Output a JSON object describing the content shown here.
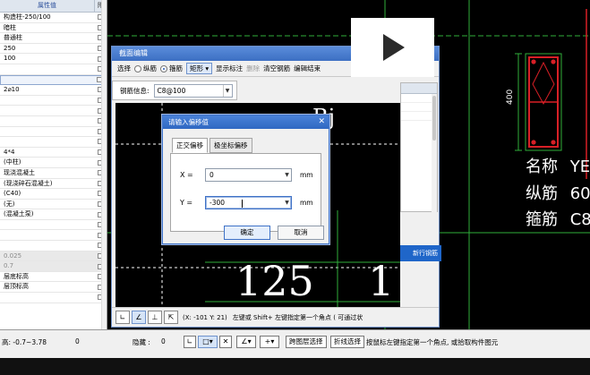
{
  "left_panel": {
    "header_value": "属性值",
    "header_attach": "附",
    "rows": [
      {
        "value": "构造柱-250/100"
      },
      {
        "value": "暗柱"
      },
      {
        "value": "普通柱"
      },
      {
        "value": "250"
      },
      {
        "value": "100"
      },
      {
        "value": ""
      },
      {
        "value": ""
      },
      {
        "value": "2⌀10"
      },
      {
        "value": ""
      },
      {
        "value": ""
      },
      {
        "value": ""
      },
      {
        "value": ""
      },
      {
        "value": ""
      },
      {
        "value": "4*4"
      },
      {
        "value": "(中柱)"
      },
      {
        "value": "现浇混凝土"
      },
      {
        "value": "(现浇碎石混凝土)"
      },
      {
        "value": "(C40)"
      },
      {
        "value": "(无)"
      },
      {
        "value": "(混凝土泵)"
      },
      {
        "value": ""
      },
      {
        "value": ""
      },
      {
        "value": ""
      },
      {
        "value": "0.025"
      },
      {
        "value": "0.7"
      },
      {
        "value": "层底标高"
      },
      {
        "value": "层顶标高"
      },
      {
        "value": ""
      }
    ]
  },
  "section_window": {
    "title": "截面编辑",
    "toolbar": {
      "select_label": "选择",
      "longitudinal_label": "纵筋",
      "stirrup_label": "箍筋",
      "rect_dropdown": "矩形",
      "show_annotation": "显示标注",
      "delete": "删除",
      "clear_rebars": "清空钢筋",
      "edit_end": "编辑结束"
    },
    "rebar_info_label": "钢筋信息:",
    "rebar_info_value": "C8@100",
    "new_row_button": "新行钢筋",
    "drawing_text": {
      "top_letters": "Bj",
      "dim_left": "125",
      "dim_right": "1"
    },
    "status": {
      "coords": "(X: -101 Y: 21)",
      "hint": "左键或 Shift+ 左键指定第一个角点 ( 可通过状"
    }
  },
  "dialog": {
    "title": "请输入偏移值",
    "tab_active": "正交偏移",
    "tab_other": "极坐标偏移",
    "x_label": "X =",
    "x_value": "0",
    "x_unit": "mm",
    "y_label": "Y =",
    "y_value": "-300",
    "y_unit": "mm",
    "ok_label": "确定",
    "cancel_label": "取消"
  },
  "right_info": {
    "name_label": "名称",
    "name_value": "YE",
    "long_label": "纵筋",
    "long_value": "60",
    "stir_label": "箍筋",
    "stir_value": "C8",
    "dim_label": "400"
  },
  "bottom_bar": {
    "height_range": "高: -0.7~3.78",
    "val_a": "0",
    "hidden_label": "隐藏 :",
    "hidden_value": "0",
    "same_floor_select": "跨图层选择",
    "polyline_select": "折线选择",
    "hint": "按鼠标左键指定第一个角点, 或拾取构件图元"
  }
}
